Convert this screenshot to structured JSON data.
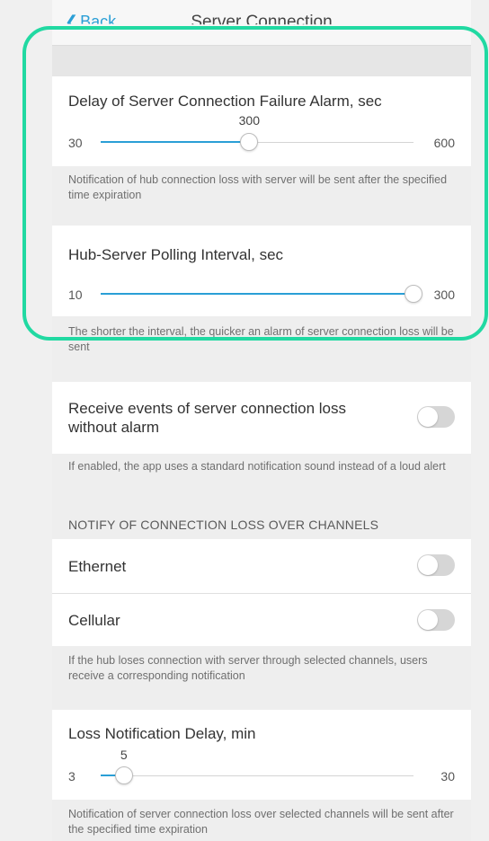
{
  "header": {
    "back_label": "Back",
    "title": "Server Connection"
  },
  "alarm_delay": {
    "label": "Delay of Server Connection Failure Alarm, sec",
    "min": "30",
    "max": "600",
    "value": "300",
    "fraction": 0.475,
    "note": "Notification of hub connection loss with server will be sent after the specified time expiration"
  },
  "polling": {
    "label": "Hub-Server Polling Interval, sec",
    "min": "10",
    "max": "300",
    "value": 300,
    "fraction": 1.0,
    "note": "The shorter the interval, the quicker an alarm of server connection loss will be sent"
  },
  "receive_events": {
    "label": "Receive events of server connection loss without alarm",
    "enabled": false,
    "note": "If enabled, the app uses a standard notification sound instead of a loud alert"
  },
  "channels": {
    "heading": "NOTIFY OF CONNECTION LOSS OVER CHANNELS",
    "ethernet": {
      "label": "Ethernet",
      "enabled": false
    },
    "cellular": {
      "label": "Cellular",
      "enabled": false
    },
    "note": "If the hub loses connection with server through selected channels, users receive a corresponding notification"
  },
  "loss_delay": {
    "label": "Loss Notification Delay, min",
    "min": "3",
    "max": "30",
    "value": "5",
    "fraction": 0.074,
    "note": "Notification of server connection loss over selected channels will be sent after the specified time expiration"
  },
  "colors": {
    "accent": "#2a9fd6",
    "highlight": "#21d9a2",
    "toggle_off": "#d6d6d6"
  }
}
